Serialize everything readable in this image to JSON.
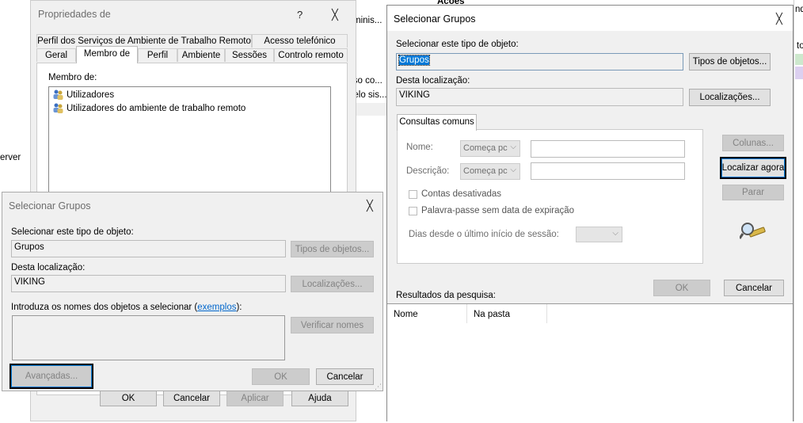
{
  "background": {
    "left_texts": [
      "erver"
    ],
    "mid_texts": [
      "minis...",
      "sso co...",
      "delo sis..."
    ],
    "acoes": "Acoes",
    "right_texts": [
      "ndi",
      "to"
    ]
  },
  "props_dialog": {
    "title": "Propriedades de",
    "help": "?",
    "close": "╳",
    "tabs_row1": [
      "Perfil dos Serviços de Ambiente de Trabalho Remoto",
      "Acesso telefónico"
    ],
    "tabs_row2": [
      "Geral",
      "Membro de",
      "Perfil",
      "Ambiente",
      "Sessões",
      "Controlo remoto"
    ],
    "member_of_label": "Membro de:",
    "members": [
      "Utilizadores",
      "Utilizadores do ambiente de trabalho remoto"
    ],
    "buttons": {
      "ok": "OK",
      "cancel": "Cancelar",
      "apply": "Aplicar",
      "help": "Ajuda"
    }
  },
  "small_select": {
    "title": "Selecionar Grupos",
    "close": "╳",
    "object_type_label": "Selecionar este tipo de objeto:",
    "object_type_value": "Grupos",
    "object_types_button": "Tipos de objetos...",
    "location_label": "Desta localização:",
    "location_value": "VIKING",
    "locations_button": "Localizações...",
    "enter_names_label": "Introduza os nomes dos objetos a selecionar (",
    "examples_link": "exemplos",
    "enter_names_suffix": "):",
    "check_names_button": "Verificar nomes",
    "advanced_button": "Avançadas...",
    "ok_button": "OK",
    "cancel_button": "Cancelar"
  },
  "big_select": {
    "title": "Selecionar Grupos",
    "close": "╳",
    "object_type_label": "Selecionar este tipo de objeto:",
    "object_type_value": "Grupos",
    "object_types_button": "Tipos de objetos...",
    "location_label": "Desta localização:",
    "location_value": "VIKING",
    "locations_button": "Localizações...",
    "common_queries_tab": "Consultas comuns",
    "name_label": "Nome:",
    "name_combo": "Começa pc",
    "description_label": "Descrição:",
    "description_combo": "Começa pc",
    "disabled_accounts": "Contas desativadas",
    "no_expire_password": "Palavra-passe sem data de expiração",
    "days_since_logon": "Dias desde o último início de sessão:",
    "columns_button": "Colunas...",
    "find_now_button": "Localizar agora",
    "stop_button": "Parar",
    "ok_button": "OK",
    "cancel_button": "Cancelar",
    "results_label": "Resultados da pesquisa:",
    "results_columns": [
      "Nome",
      "Na pasta"
    ]
  }
}
